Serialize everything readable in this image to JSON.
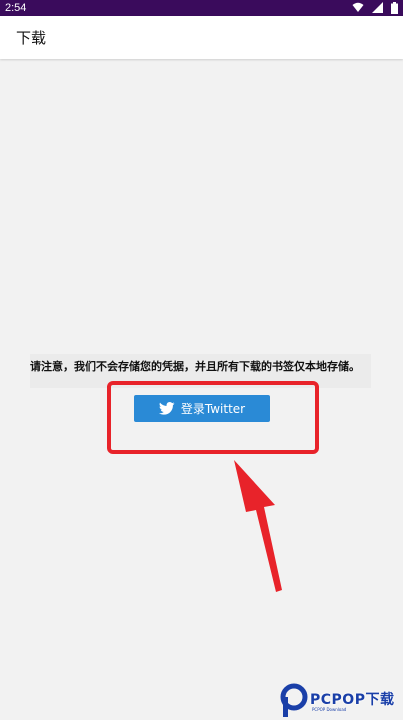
{
  "status_bar": {
    "time": "2:54",
    "icons": [
      "wifi-icon",
      "signal-icon",
      "battery-icon"
    ]
  },
  "app_bar": {
    "title": "下载"
  },
  "main": {
    "notice": "请注意，我们不会存储您的凭据，并且所有下载的书签仅本地存储。",
    "login_button_label": "登录Twitter",
    "login_button_icon": "twitter-bird-icon"
  },
  "annotation": {
    "color": "#e8232a"
  },
  "watermark": {
    "brand": "PCPOP下载",
    "sub": "PCPOP Download"
  },
  "colors": {
    "status_bar": "#3a0b5c",
    "button": "#2a8ad6",
    "background": "#f2f2f2",
    "watermark": "#1a3fa8"
  }
}
